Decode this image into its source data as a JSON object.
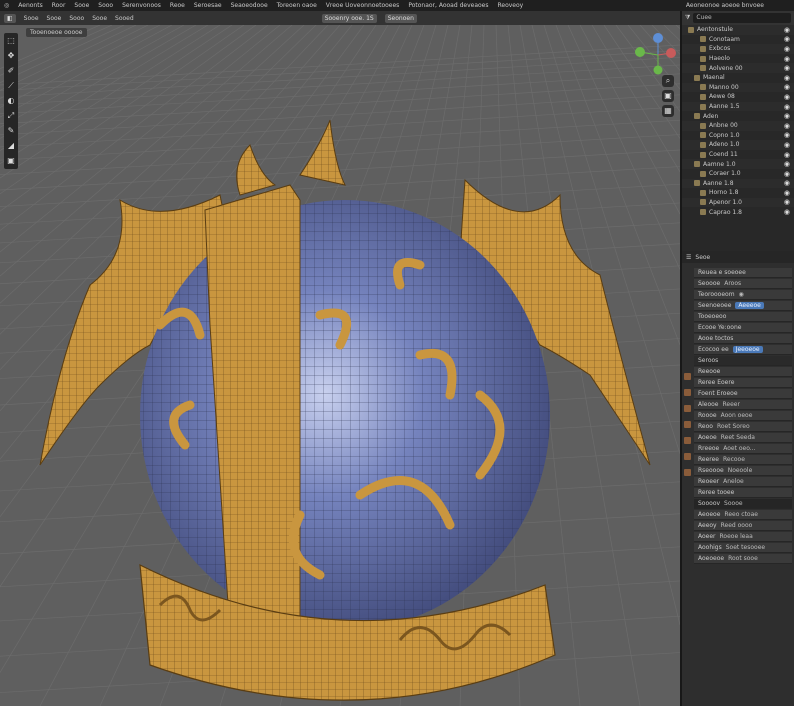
{
  "menubar": {
    "items": [
      "Aenonts",
      "Roor",
      "Sooe",
      "Sooo",
      "Serenvonoos",
      "Reoe",
      "Seroesae",
      "Seaoeodooe",
      "Toreoen oaoe",
      "Vreoe Uoveonnoetooees",
      "Potonaor, Aooad deveaoes",
      "Reoveoy"
    ],
    "title": "Aeoneonoe aoeoe bnvoee"
  },
  "header": {
    "items": [
      "Sooe",
      "Sooe",
      "Sooo",
      "Sooe",
      "Sooed"
    ],
    "view_label": "Sooenry ooe. 1S",
    "shading": "Seonoen"
  },
  "viewport": {
    "mode_label": "Tooenoeoe ooooe",
    "toolbar_icons": [
      "select-icon",
      "cursor-icon",
      "move-icon",
      "rotate-icon",
      "scale-icon",
      "transform-icon",
      "annotate-icon",
      "measure-icon",
      "add-cube-icon"
    ],
    "colors": {
      "gold": "#c9963f",
      "blue": "#6d7cb4",
      "bg": "#5f5f5f"
    }
  },
  "outliner": {
    "search": "Cuee",
    "rows": [
      "Aentonstule",
      "Conotaam",
      "Exbcos",
      "Haeolo",
      "Aolvene 00",
      "Maenal",
      "Manno 00",
      "Aewe 08",
      "Aanne 1.5",
      "Aden",
      "Anbne 00",
      "Copno 1.0",
      "Adeno 1.0",
      "Coend 11",
      "Aamne 1.0",
      "Coraer 1.0",
      "Aanne 1.8",
      "Horno 1.8",
      "Apenor 1.0",
      "Caprao 1.8"
    ]
  },
  "properties": {
    "tab": "Seoe",
    "rows": [
      {
        "l": "Reuea e soeoee",
        "v": ""
      },
      {
        "l": "Seoooe",
        "v": "Aroos"
      },
      {
        "l": "Teoroooeom",
        "v": "◉"
      },
      {
        "l": "Seenoeoee",
        "v": "Aeeeoe",
        "hl": true
      },
      {
        "l": "Tooeoeoo",
        "v": ""
      },
      {
        "l": "Ecooe Ye:oone",
        "v": ""
      },
      {
        "l": "Aooe toctos",
        "v": ""
      },
      {
        "l": "Ecocoo ee",
        "v": "Jeeoeoe",
        "hl": true
      },
      {
        "l": "Seroos",
        "v": "",
        "sec": true
      },
      {
        "l": "Reeooe",
        "v": ""
      },
      {
        "l": "Reree Eoere",
        "v": ""
      },
      {
        "l": "Foent Eroeoe",
        "v": ""
      },
      {
        "l": "Aleooe",
        "v": "Reeer"
      },
      {
        "l": "Roooe",
        "v": "Aoon oeoe"
      },
      {
        "l": "Reoo",
        "v": "Roet Soreo"
      },
      {
        "l": "Aoeoe",
        "v": "Reet Seeda"
      },
      {
        "l": "Rreeoe",
        "v": "Aoet oeo..."
      },
      {
        "l": "Reeree",
        "v": "Recooe"
      },
      {
        "l": "Rseoooe",
        "v": "Noeoole"
      },
      {
        "l": "Reoeer",
        "v": "Aneloe"
      },
      {
        "l": "Reree tooee",
        "v": ""
      },
      {
        "l": "Soooov",
        "v": "Soooe",
        "dark": true
      },
      {
        "l": "Aeoeoe",
        "v": "Reeo ctoae"
      },
      {
        "l": "Aeeoy",
        "v": "Reed oooo"
      },
      {
        "l": "Aoeer",
        "v": "Roeoe leaa"
      },
      {
        "l": "Aoohigs",
        "v": "Soet tesooee"
      },
      {
        "l": "Aoeoeoe",
        "v": "Root sooe"
      }
    ]
  }
}
